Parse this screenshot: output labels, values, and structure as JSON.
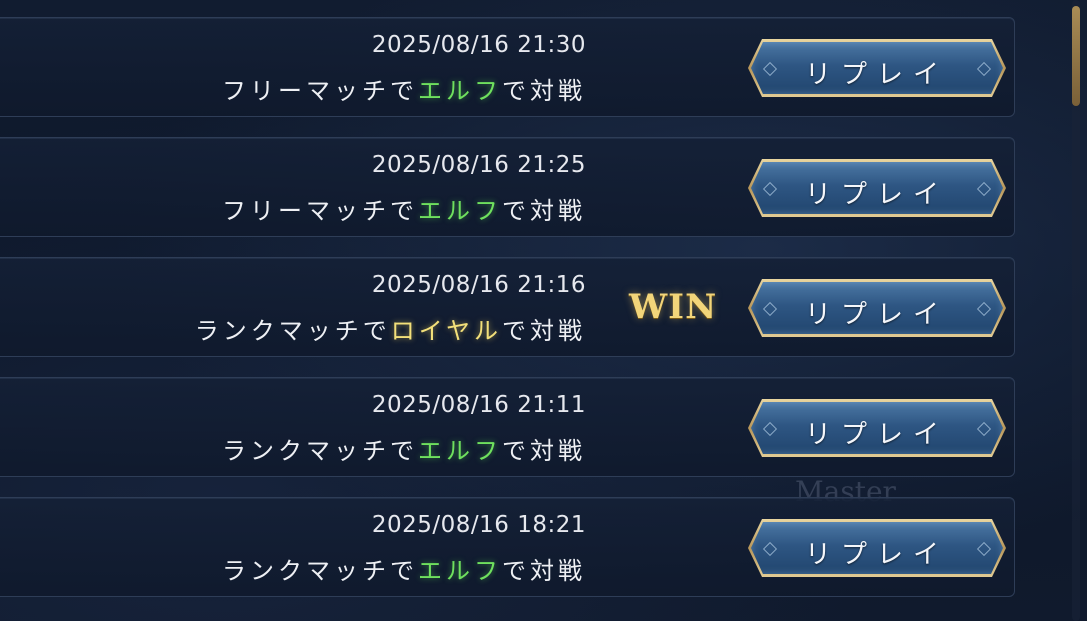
{
  "matches": [
    {
      "datetime": "2025/08/16 21:30",
      "mode": "フリーマッチで",
      "class_name": "エルフ",
      "class_color": "green",
      "suffix": "で対戦",
      "result": "",
      "replay_label": "リプレイ"
    },
    {
      "datetime": "2025/08/16 21:25",
      "mode": "フリーマッチで",
      "class_name": "エルフ",
      "class_color": "green",
      "suffix": "で対戦",
      "result": "",
      "replay_label": "リプレイ"
    },
    {
      "datetime": "2025/08/16 21:16",
      "mode": "ランクマッチで",
      "class_name": "ロイヤル",
      "class_color": "gold",
      "suffix": "で対戦",
      "result": "WIN",
      "replay_label": "リプレイ"
    },
    {
      "datetime": "2025/08/16 21:11",
      "mode": "ランクマッチで",
      "class_name": "エルフ",
      "class_color": "green",
      "suffix": "で対戦",
      "result": "",
      "replay_label": "リプレイ"
    },
    {
      "datetime": "2025/08/16 18:21",
      "mode": "ランクマッチで",
      "class_name": "エルフ",
      "class_color": "green",
      "suffix": "で対戦",
      "result": "",
      "replay_label": "リプレイ"
    }
  ],
  "background_text": "Master",
  "colors": {
    "highlight_green": "#6fe05e",
    "highlight_gold": "#f3e07a",
    "win_gold": "#f2d57a",
    "button_blue": "#2e5683",
    "button_border_gold": "#d8c08a"
  }
}
